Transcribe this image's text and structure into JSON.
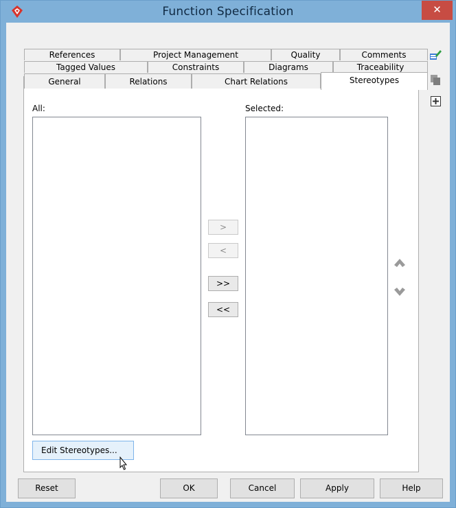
{
  "window": {
    "title": "Function Specification",
    "close_label": "✕"
  },
  "tabs": {
    "row1": [
      "References",
      "Project Management",
      "Quality",
      "Comments"
    ],
    "row2": [
      "Tagged Values",
      "Constraints",
      "Diagrams",
      "Traceability"
    ],
    "row3": [
      "General",
      "Relations",
      "Chart Relations",
      "Stereotypes"
    ],
    "active": "Stereotypes"
  },
  "stereotypes": {
    "all_label": "All:",
    "selected_label": "Selected:",
    "move_right": ">",
    "move_left": "<",
    "move_all_right": ">>",
    "move_all_left": "<<",
    "edit_button": "Edit Stereotypes..."
  },
  "footer": {
    "reset": "Reset",
    "ok": "OK",
    "cancel": "Cancel",
    "apply": "Apply",
    "help": "Help"
  },
  "colors": {
    "titlebar": "#7fb0d8",
    "close": "#c74c43",
    "accent": "#7eb4ea"
  }
}
